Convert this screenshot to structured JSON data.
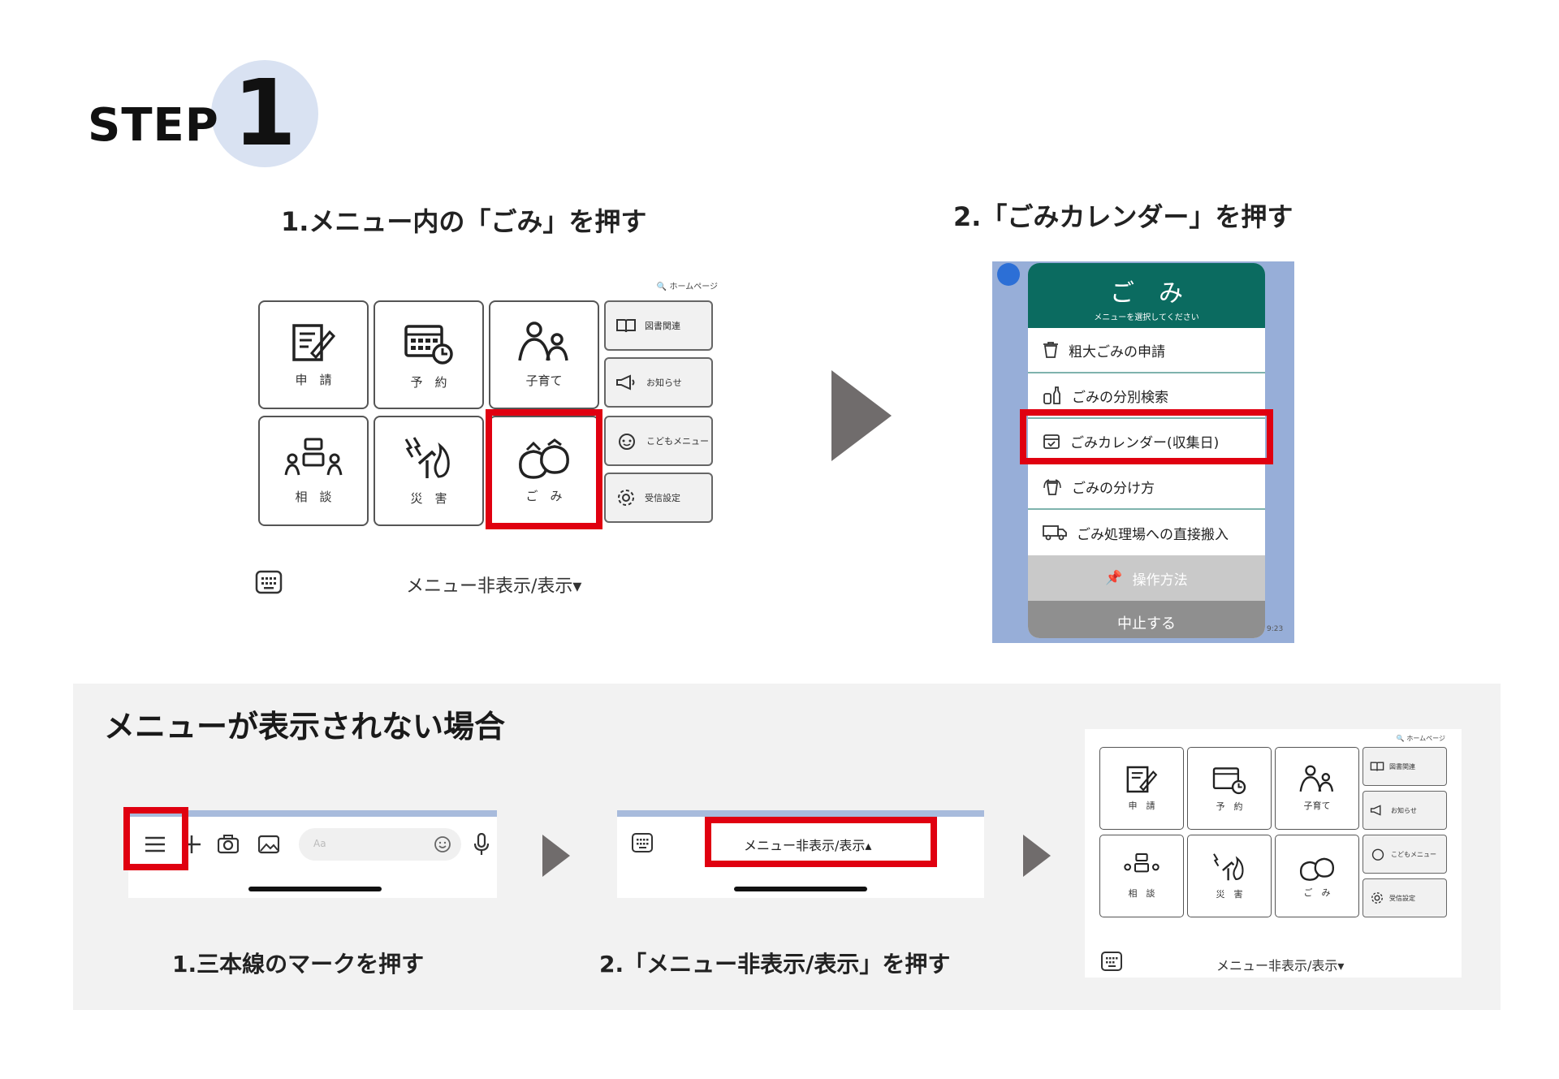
{
  "step": {
    "word": "STEP",
    "number": "1"
  },
  "captions": {
    "top_left": "1.メニュー内の「ごみ」を押す",
    "top_right": "2.「ごみカレンダー」を押す",
    "bottom_left": "1.三本線のマークを押す",
    "bottom_mid": "2.「メニュー非表示/表示」を押す"
  },
  "rich_menu": {
    "homepage_link": "ホームページ",
    "tiles": [
      "申　請",
      "予　約",
      "子育て",
      "相　談",
      "災　害",
      "ご　み"
    ],
    "side_buttons": [
      "図書関連",
      "お知らせ",
      "こどもメニュー",
      "受信設定"
    ],
    "toggle_label": "メニュー非表示/表示▾"
  },
  "gomi_menu": {
    "title": "ご　み",
    "subtitle": "メニューを選択してください",
    "items": [
      "粗大ごみの申請",
      "ごみの分別検索",
      "ごみカレンダー(収集日)",
      "ごみの分け方",
      "ごみ処理場への直接搬入"
    ],
    "howto": "操作方法",
    "cancel": "中止する",
    "time": "9:23"
  },
  "panel": {
    "heading": "メニューが表示されない場合",
    "input_placeholder": "Aa",
    "toggle_up_label": "メニュー非表示/表示▴"
  },
  "colors": {
    "highlight": "#e00010",
    "gomi_header": "#0b6b60",
    "step_circle": "#d9e2f2",
    "arrow": "#706c6c"
  }
}
